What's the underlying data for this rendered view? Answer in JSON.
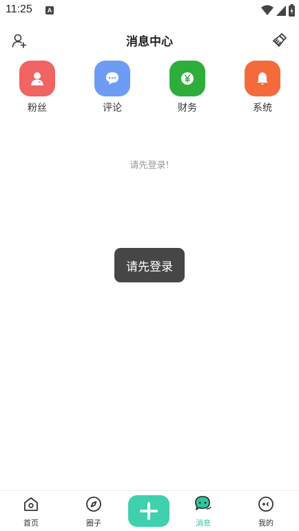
{
  "status": {
    "time": "11:25",
    "badge": "A"
  },
  "header": {
    "title": "消息中心",
    "left_icon": "add-user-icon",
    "right_icon": "broom-icon"
  },
  "categories": [
    {
      "label": "粉丝",
      "color": "#f06463",
      "icon": "user-icon"
    },
    {
      "label": "评论",
      "color": "#6d9cf5",
      "icon": "chat-icon"
    },
    {
      "label": "财务",
      "color": "#2fad3a",
      "icon": "yen-icon"
    },
    {
      "label": "系统",
      "color": "#f56a3a",
      "icon": "bell-icon"
    }
  ],
  "empty": {
    "message": "请先登录!"
  },
  "toast": {
    "message": "请先登录"
  },
  "tabbar": {
    "accent": "#2ec5a0",
    "tabs": [
      {
        "label": "首页",
        "icon": "home-icon"
      },
      {
        "label": "圈子",
        "icon": "compass-icon"
      },
      {
        "label": "消息",
        "icon": "message-icon",
        "active": true
      },
      {
        "label": "我的",
        "icon": "profile-icon"
      }
    ],
    "add_icon": "plus-icon"
  }
}
